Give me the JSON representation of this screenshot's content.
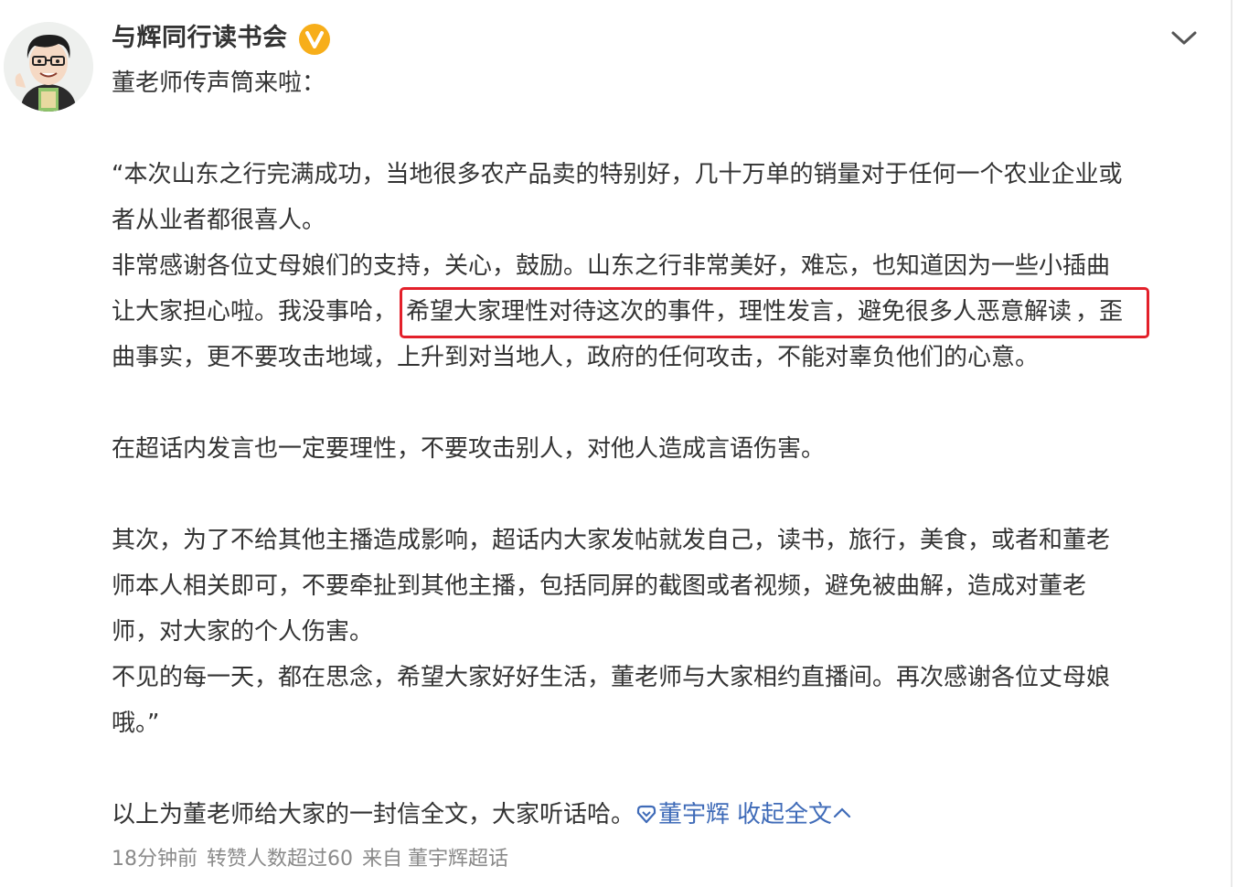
{
  "author": {
    "name": "与辉同行读书会",
    "verified_icon": "verified-v-badge-icon",
    "badge_color": "#f7ae1a"
  },
  "post": {
    "intro": "董老师传声筒来啦：",
    "lines": {
      "l1": "“本次山东之行完满成功，当地很多农产品卖的特别好，几十万单的销量对于任何一个农业企业或",
      "l2": "者从业者都很喜人。",
      "l3": "非常感谢各位丈母娘们的支持，关心，鼓励。山东之行非常美好，难忘，也知道因为一些小插曲",
      "l4a": "让大家担心啦。我没事哈，",
      "l4b": "希望大家理性对待这次的事件，理性发言，避免很多人恶意解读",
      "l4c": "，歪",
      "l5": "曲事实，更不要攻击地域，上升到对当地人，政府的任何攻击，不能对辜负他们的心意。",
      "l6": "在超话内发言也一定要理性，不要攻击别人，对他人造成言语伤害。",
      "l7": "其次，为了不给其他主播造成影响，超话内大家发帖就发自己，读书，旅行，美食，或者和董老",
      "l8": "师本人相关即可，不要牵扯到其他主播，包括同屏的截图或者视频，避免被曲解，造成对董老",
      "l9": "师，对大家的个人伤害。",
      "l10": "不见的每一天，都在思念，希望大家好好生活，董老师与大家相约直播间。再次感谢各位丈母娘",
      "l11": "哦。”",
      "l12": "以上为董老师给大家的一封信全文，大家听话哈。"
    },
    "highlight_color": "#e3202a",
    "topic_link": "董宇辉",
    "collapse_label": "收起全文",
    "link_color": "#3f6bb8"
  },
  "footer": {
    "time": "18分钟前",
    "reposts": "转赞人数超过60",
    "source_prefix": "来自",
    "source": "董宇辉超话"
  }
}
